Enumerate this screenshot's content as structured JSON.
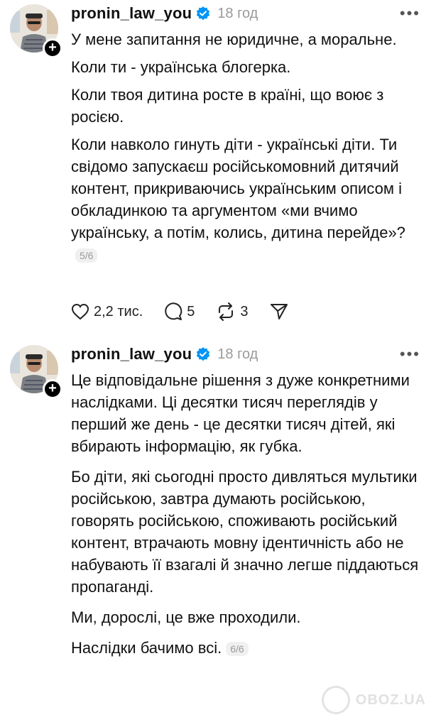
{
  "posts": [
    {
      "username": "pronin_law_you",
      "time": "18 год",
      "paragraphs": [
        "У мене запитання не юридичне, а моральне.",
        "Коли ти - українська блогерка.",
        "Коли твоя дитина росте в країні, що воює з росією.",
        "Коли навколо гинуть діти - українські діти. Ти свідомо запускаєш російськомовний дитячий контент, прикриваючись українським описом і обкладинкою та аргументом «ми вчимо українську, а потім, колись, дитина перейде»?"
      ],
      "page": "5/6",
      "likes": "2,2 тис.",
      "comments": "5",
      "reposts": "3"
    },
    {
      "username": "pronin_law_you",
      "time": "18 год",
      "paragraphs": [
        "Це відповідальне рішення з дуже конкретними наслідками. Ці десятки тисяч переглядів у перший же день - це десятки тисяч дітей, які вбирають інформацію, як губка.",
        "Бо діти, які сьогодні просто дивляться мультики російською, завтра думають російською, говорять російською, споживають російський контент, втрачають мовну ідентичність або не набувають її взагалі й значно легше піддаються пропаганді.",
        "Ми, дорослі, це вже проходили.",
        "Наслідки бачимо всі."
      ],
      "page": "6/6"
    }
  ],
  "watermark": "OBOZ.UA",
  "colors": {
    "text": "#111111",
    "muted": "#9a9a9a",
    "verified": "#0095f6"
  }
}
